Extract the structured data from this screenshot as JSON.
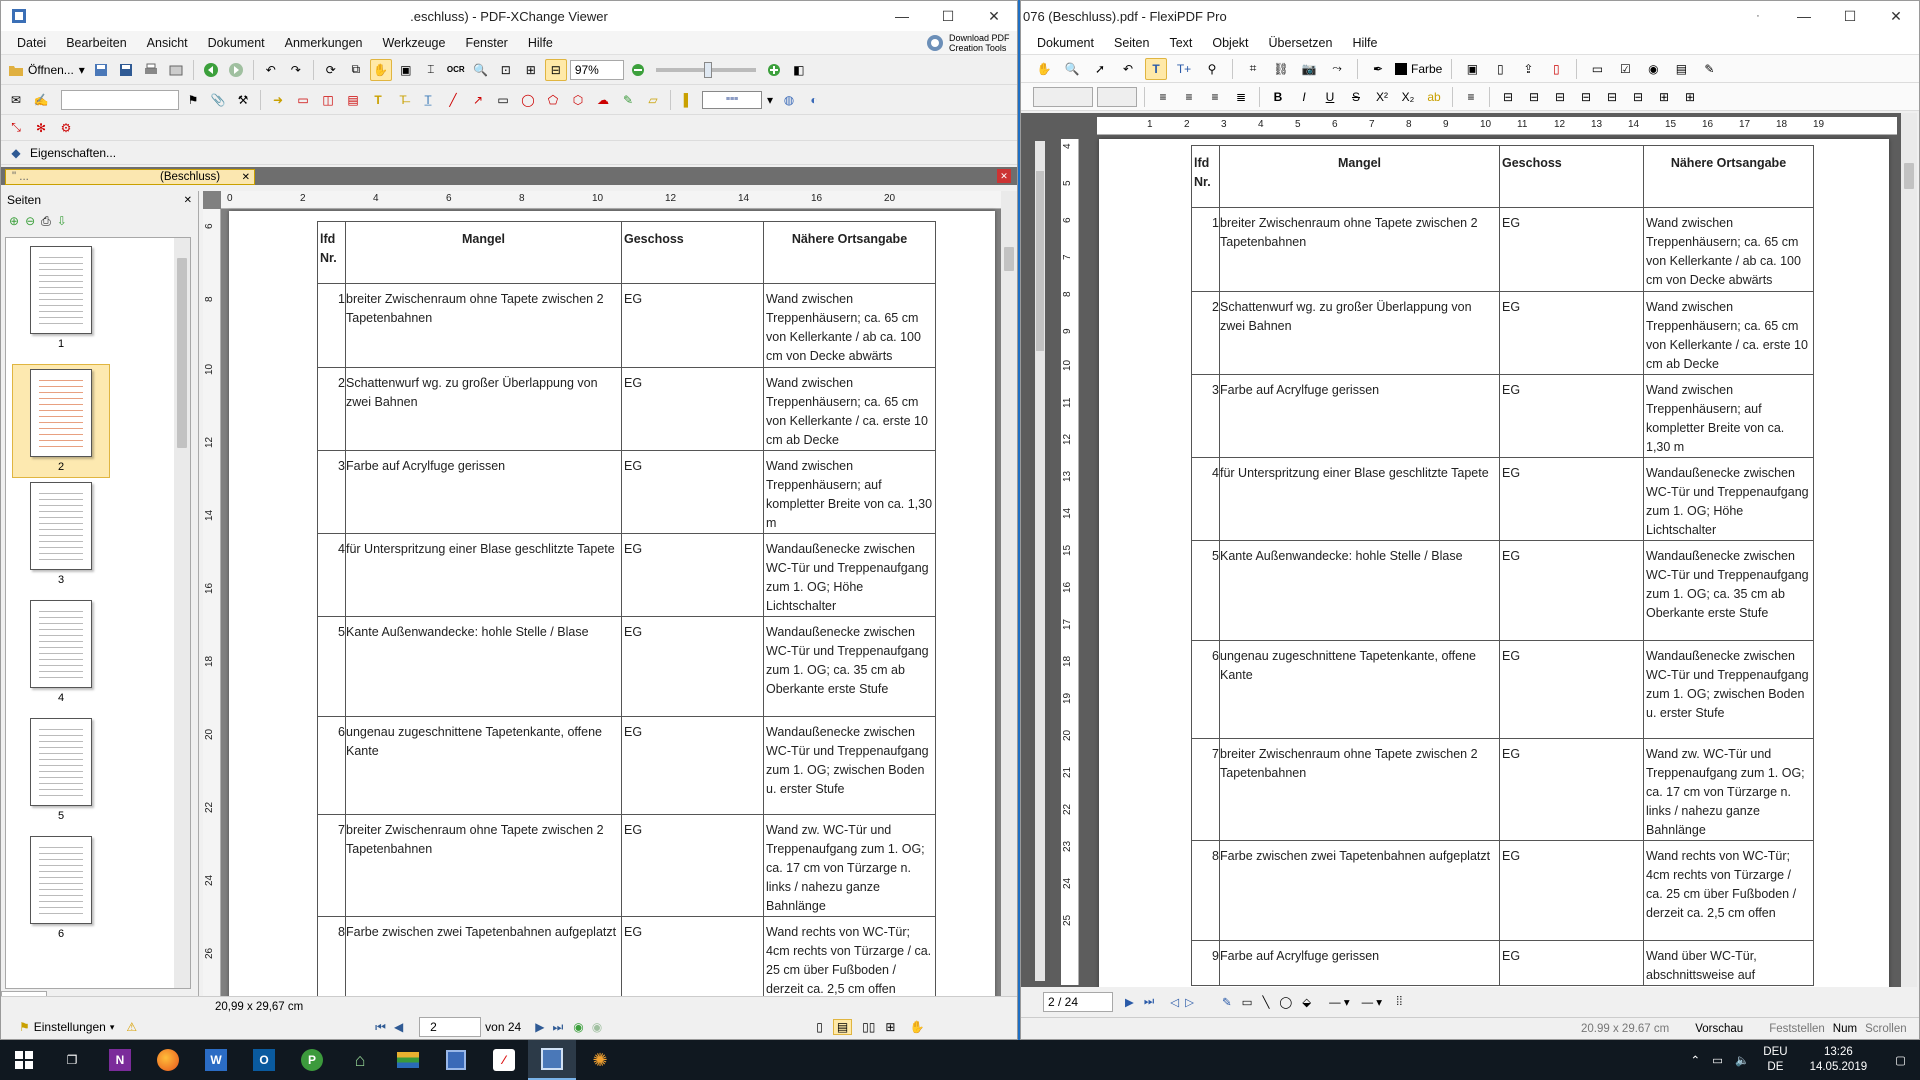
{
  "pxc": {
    "title": ".eschluss) - PDF-XChange Viewer",
    "menu": [
      "Datei",
      "Bearbeiten",
      "Ansicht",
      "Dokument",
      "Anmerkungen",
      "Werkzeuge",
      "Fenster",
      "Hilfe"
    ],
    "download_promo": "Download PDF Creation Tools",
    "toolbar": {
      "open_label": "Öffnen...",
      "zoom": "97%",
      "ocr_label": "OCR"
    },
    "properties_label": "Eigenschaften...",
    "tab_prefix": "\" ...",
    "tab_label": "(Beschluss)",
    "pages_panel_title": "Seiten",
    "pages_tab_label": "Seiten",
    "thumbnails": [
      {
        "label": "1"
      },
      {
        "label": "2"
      },
      {
        "label": "3"
      },
      {
        "label": "4"
      },
      {
        "label": "5"
      },
      {
        "label": "6"
      }
    ],
    "ruler_h": [
      "0",
      "2",
      "4",
      "6",
      "8",
      "10",
      "12",
      "14",
      "16",
      "20"
    ],
    "ruler_v": [
      "6",
      "8",
      "10",
      "12",
      "14",
      "16",
      "18",
      "20",
      "22",
      "24",
      "26"
    ],
    "page_size": "20,99 x 29,67 cm",
    "current_page": "2",
    "page_total": "von 24",
    "settings_label": "Einstellungen"
  },
  "fx": {
    "title": "076 (Beschluss).pdf - FlexiPDF Pro",
    "menu": [
      "Dokument",
      "Seiten",
      "Text",
      "Objekt",
      "Übersetzen",
      "Hilfe"
    ],
    "color_label": "Farbe",
    "ruler_h": [
      "1",
      "2",
      "3",
      "4",
      "5",
      "6",
      "7",
      "8",
      "9",
      "10",
      "11",
      "12",
      "13",
      "14",
      "15",
      "16",
      "17",
      "18",
      "19"
    ],
    "ruler_v": [
      "4",
      "5",
      "6",
      "7",
      "8",
      "9",
      "10",
      "11",
      "12",
      "13",
      "14",
      "15",
      "16",
      "17",
      "18",
      "19",
      "20",
      "21",
      "22",
      "23",
      "24",
      "25"
    ],
    "page_indicator": "2 / 24",
    "status": {
      "size": "20.99 x 29.67 cm",
      "preview": "Vorschau",
      "fixed": "Feststellen",
      "num": "Num",
      "scroll": "Scrollen"
    }
  },
  "table": {
    "headers": {
      "nr": "lfd Nr.",
      "mangel": "Mangel",
      "geschoss": "Geschoss",
      "ort": "Nähere Ortsangabe"
    },
    "rows": [
      {
        "nr": "1",
        "mangel": "breiter Zwischenraum ohne Tapete zwischen 2 Tapetenbahnen",
        "geschoss": "EG",
        "ort": "Wand zwischen Treppenhäusern; ca. 65 cm von Kellerkante / ab ca. 100 cm von Decke abwärts"
      },
      {
        "nr": "2",
        "mangel": "Schattenwurf wg. zu großer Überlappung von zwei Bahnen",
        "geschoss": "EG",
        "ort": "Wand zwischen Treppenhäusern; ca. 65 cm von Kellerkante / ca. erste 10 cm ab Decke"
      },
      {
        "nr": "3",
        "mangel": "Farbe auf Acrylfuge gerissen",
        "geschoss": "EG",
        "ort": "Wand zwischen Treppenhäusern; auf kompletter Breite von ca. 1,30 m"
      },
      {
        "nr": "4",
        "mangel": "für Unterspritzung einer Blase geschlitzte Tapete",
        "geschoss": "EG",
        "ort": "Wandaußenecke zwischen WC-Tür und Treppenaufgang zum 1. OG; Höhe Lichtschalter"
      },
      {
        "nr": "5",
        "mangel": "Kante Außenwandecke: hohle Stelle / Blase",
        "geschoss": "EG",
        "ort": "Wandaußenecke zwischen WC-Tür und Treppenaufgang zum 1. OG; ca. 35 cm ab Oberkante erste Stufe"
      },
      {
        "nr": "6",
        "mangel": "ungenau zugeschnittene Tapetenkante, offene Kante",
        "geschoss": "EG",
        "ort": "Wandaußenecke zwischen WC-Tür und Treppenaufgang zum 1. OG; zwischen Boden u. erster Stufe"
      },
      {
        "nr": "7",
        "mangel": "breiter Zwischenraum ohne Tapete zwischen 2 Tapetenbahnen",
        "geschoss": "EG",
        "ort": "Wand zw. WC-Tür und Treppenaufgang zum 1. OG; ca. 17 cm von Türzarge n. links / nahezu ganze Bahnlänge"
      },
      {
        "nr": "8",
        "mangel": "Farbe zwischen zwei Tapetenbahnen aufgeplatzt",
        "geschoss": "EG",
        "ort": "Wand rechts von WC-Tür; 4cm rechts von Türzarge / ca. 25 cm über Fußboden / derzeit ca. 2,5 cm offen"
      },
      {
        "nr": "9",
        "mangel": "Farbe auf Acrylfuge gerissen",
        "geschoss": "EG",
        "ort": "Wand über WC-Tür, abschnittsweise auf"
      }
    ]
  },
  "taskbar": {
    "lang": "DEU",
    "lang2": "DE",
    "time": "13:26",
    "date": "14.05.2019"
  }
}
